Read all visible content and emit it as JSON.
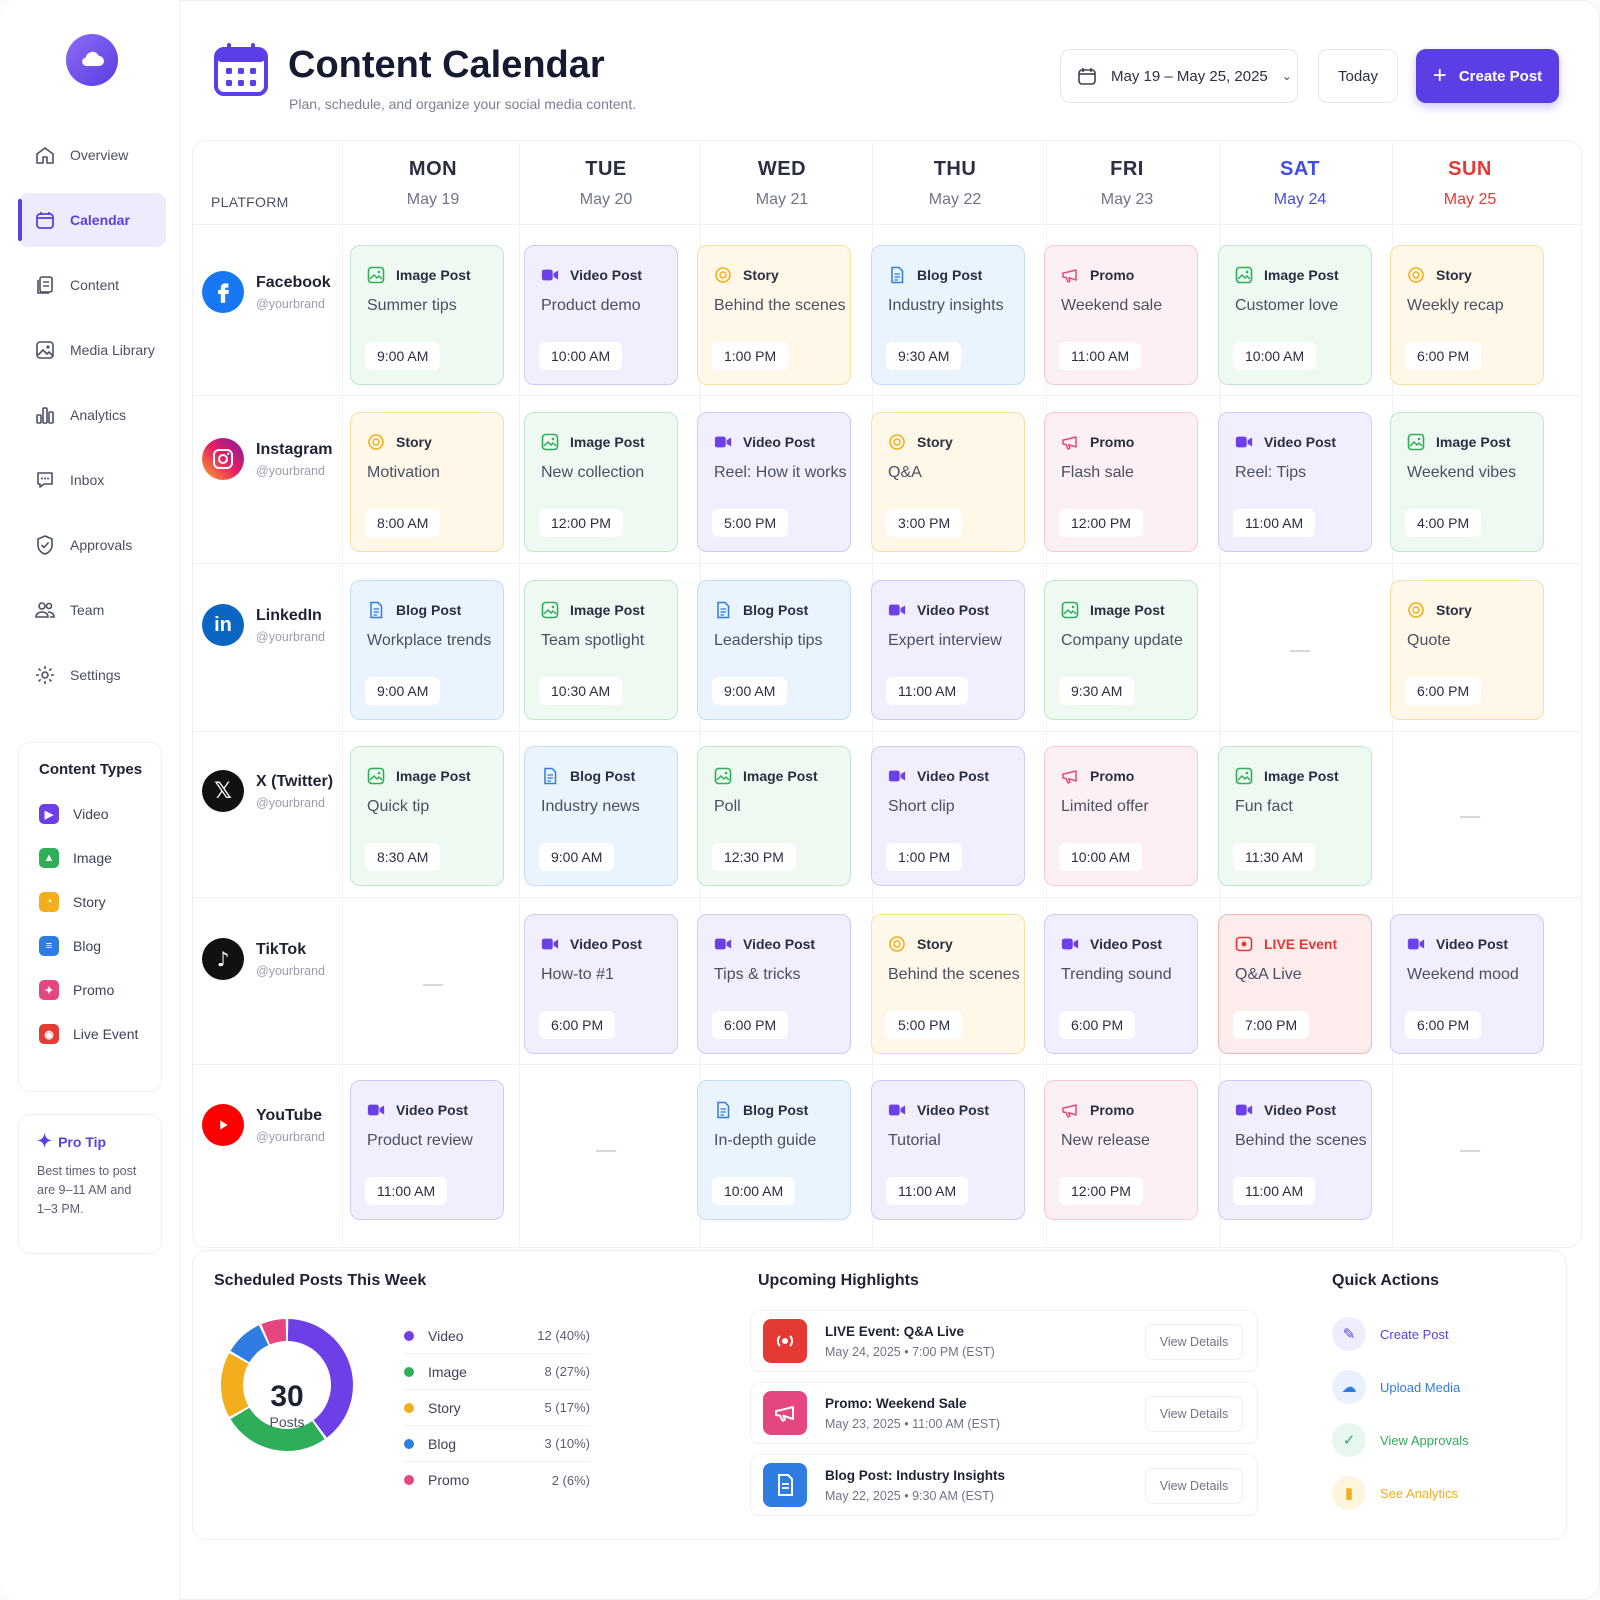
{
  "app": {
    "title": "Content Calendar",
    "subtitle": "Plan, schedule, and organize your social media content."
  },
  "header": {
    "date_range": "May 19 – May 25, 2025",
    "today_label": "Today",
    "create_label": "Create Post"
  },
  "colors": {
    "accent": "#5b3fe4",
    "video": "#6d3fe6",
    "image": "#2fae5a",
    "story": "#f2ae1c",
    "blog": "#2f7de1",
    "promo": "#e64680",
    "live": "#e53935"
  },
  "sidebar": {
    "items": [
      {
        "label": "Overview",
        "icon": "home-icon"
      },
      {
        "label": "Calendar",
        "icon": "calendar-icon",
        "active": true
      },
      {
        "label": "Content",
        "icon": "content-icon"
      },
      {
        "label": "Media Library",
        "icon": "image-icon"
      },
      {
        "label": "Analytics",
        "icon": "bar-chart-icon"
      },
      {
        "label": "Inbox",
        "icon": "chat-icon"
      },
      {
        "label": "Approvals",
        "icon": "shield-check-icon"
      },
      {
        "label": "Team",
        "icon": "team-icon"
      },
      {
        "label": "Settings",
        "icon": "gear-icon"
      }
    ],
    "content_types_title": "Content Types",
    "content_types": [
      "Video",
      "Image",
      "Story",
      "Blog",
      "Promo",
      "Live Event"
    ],
    "tip_title": "Pro Tip",
    "tip_text": "Best times to post are 9–11 AM and 1–3 PM."
  },
  "calendar": {
    "platform_header": "PLATFORM",
    "days": [
      {
        "name": "MON",
        "date": "May 19"
      },
      {
        "name": "TUE",
        "date": "May 20"
      },
      {
        "name": "WED",
        "date": "May 21"
      },
      {
        "name": "THU",
        "date": "May 22"
      },
      {
        "name": "FRI",
        "date": "May 23"
      },
      {
        "name": "SAT",
        "date": "May 24"
      },
      {
        "name": "SUN",
        "date": "May 25"
      }
    ],
    "platforms": [
      {
        "name": "Facebook",
        "handle": "@yourbrand",
        "posts": [
          {
            "type": "Image Post",
            "kind": "image",
            "title": "Summer tips",
            "time": "9:00 AM"
          },
          {
            "type": "Video Post",
            "kind": "video",
            "title": "Product demo",
            "time": "10:00 AM"
          },
          {
            "type": "Story",
            "kind": "story",
            "title": "Behind the scenes",
            "time": "1:00 PM"
          },
          {
            "type": "Blog Post",
            "kind": "blog",
            "title": "Industry insights",
            "time": "9:30 AM"
          },
          {
            "type": "Promo",
            "kind": "promo",
            "title": "Weekend sale",
            "time": "11:00 AM"
          },
          {
            "type": "Image Post",
            "kind": "image",
            "title": "Customer love",
            "time": "10:00 AM"
          },
          {
            "type": "Story",
            "kind": "story",
            "title": "Weekly recap",
            "time": "6:00 PM"
          }
        ]
      },
      {
        "name": "Instagram",
        "handle": "@yourbrand",
        "posts": [
          {
            "type": "Story",
            "kind": "story",
            "title": "Motivation",
            "time": "8:00 AM"
          },
          {
            "type": "Image Post",
            "kind": "image",
            "title": "New collection",
            "time": "12:00 PM"
          },
          {
            "type": "Video Post",
            "kind": "video",
            "title": "Reel: How it works",
            "time": "5:00 PM"
          },
          {
            "type": "Story",
            "kind": "story",
            "title": "Q&A",
            "time": "3:00 PM"
          },
          {
            "type": "Promo",
            "kind": "promo",
            "title": "Flash sale",
            "time": "12:00 PM"
          },
          {
            "type": "Video Post",
            "kind": "video",
            "title": "Reel: Tips",
            "time": "11:00 AM"
          },
          {
            "type": "Image Post",
            "kind": "image",
            "title": "Weekend vibes",
            "time": "4:00 PM"
          }
        ]
      },
      {
        "name": "LinkedIn",
        "handle": "@yourbrand",
        "posts": [
          {
            "type": "Blog Post",
            "kind": "blog",
            "title": "Workplace trends",
            "time": "9:00 AM"
          },
          {
            "type": "Image Post",
            "kind": "image",
            "title": "Team spotlight",
            "time": "10:30 AM"
          },
          {
            "type": "Blog Post",
            "kind": "blog",
            "title": "Leadership tips",
            "time": "9:00 AM"
          },
          {
            "type": "Video Post",
            "kind": "video",
            "title": "Expert interview",
            "time": "11:00 AM"
          },
          {
            "type": "Image Post",
            "kind": "image",
            "title": "Company update",
            "time": "9:30 AM"
          },
          null,
          {
            "type": "Story",
            "kind": "story",
            "title": "Quote",
            "time": "6:00 PM"
          }
        ]
      },
      {
        "name": "X (Twitter)",
        "handle": "@yourbrand",
        "posts": [
          {
            "type": "Image Post",
            "kind": "image",
            "title": "Quick tip",
            "time": "8:30 AM"
          },
          {
            "type": "Blog Post",
            "kind": "blog",
            "title": "Industry news",
            "time": "9:00 AM"
          },
          {
            "type": "Image Post",
            "kind": "image",
            "title": "Poll",
            "time": "12:30 PM"
          },
          {
            "type": "Video Post",
            "kind": "video",
            "title": "Short clip",
            "time": "1:00 PM"
          },
          {
            "type": "Promo",
            "kind": "promo",
            "title": "Limited offer",
            "time": "10:00 AM"
          },
          {
            "type": "Image Post",
            "kind": "image",
            "title": "Fun fact",
            "time": "11:30 AM"
          },
          null
        ]
      },
      {
        "name": "TikTok",
        "handle": "@yourbrand",
        "posts": [
          null,
          {
            "type": "Video Post",
            "kind": "video",
            "title": "How-to #1",
            "time": "6:00 PM"
          },
          {
            "type": "Video Post",
            "kind": "video",
            "title": "Tips & tricks",
            "time": "6:00 PM"
          },
          {
            "type": "Story",
            "kind": "story",
            "title": "Behind the scenes",
            "time": "5:00 PM"
          },
          {
            "type": "Video Post",
            "kind": "video",
            "title": "Trending sound",
            "time": "6:00 PM"
          },
          {
            "type": "LIVE Event",
            "kind": "live",
            "title": "Q&A Live",
            "time": "7:00 PM"
          },
          {
            "type": "Video Post",
            "kind": "video",
            "title": "Weekend mood",
            "time": "6:00 PM"
          }
        ]
      },
      {
        "name": "YouTube",
        "handle": "@yourbrand",
        "posts": [
          {
            "type": "Video Post",
            "kind": "video",
            "title": "Product review",
            "time": "11:00 AM"
          },
          null,
          {
            "type": "Blog Post",
            "kind": "blog",
            "title": "In-depth guide",
            "time": "10:00 AM"
          },
          {
            "type": "Video Post",
            "kind": "video",
            "title": "Tutorial",
            "time": "11:00 AM"
          },
          {
            "type": "Promo",
            "kind": "promo",
            "title": "New release",
            "time": "12:00 PM"
          },
          {
            "type": "Video Post",
            "kind": "video",
            "title": "Behind the scenes",
            "time": "11:00 AM"
          },
          null
        ]
      }
    ]
  },
  "summary": {
    "title": "Scheduled Posts This Week",
    "total": "30",
    "total_label": "Posts",
    "chart_data": {
      "type": "pie",
      "categories": [
        "Video",
        "Image",
        "Story",
        "Blog",
        "Promo"
      ],
      "values": [
        12,
        8,
        5,
        3,
        2
      ],
      "labels": [
        "12 (40%)",
        "8 (27%)",
        "5 (17%)",
        "3 (10%)",
        "2 (6%)"
      ],
      "colors": [
        "#6d3fe6",
        "#2fae5a",
        "#f2ae1c",
        "#2f7de1",
        "#e64680"
      ]
    }
  },
  "highlights": {
    "title": "Upcoming Highlights",
    "items": [
      {
        "title": "LIVE Event: Q&A Live",
        "date": "May 24, 2025  •  7:00 PM (EST)",
        "button": "View Details",
        "icon": "live-icon"
      },
      {
        "title": "Promo: Weekend Sale",
        "date": "May 23, 2025  •  11:00 AM (EST)",
        "button": "View Details",
        "icon": "megaphone-icon"
      },
      {
        "title": "Blog Post: Industry Insights",
        "date": "May 22, 2025  •  9:30 AM (EST)",
        "button": "View Details",
        "icon": "document-icon"
      }
    ]
  },
  "quick_actions": {
    "title": "Quick Actions",
    "items": [
      {
        "label": "Create Post",
        "icon": "pencil-icon"
      },
      {
        "label": "Upload Media",
        "icon": "upload-icon"
      },
      {
        "label": "View Approvals",
        "icon": "check-circle-icon"
      },
      {
        "label": "See Analytics",
        "icon": "bar-chart-icon"
      }
    ]
  }
}
